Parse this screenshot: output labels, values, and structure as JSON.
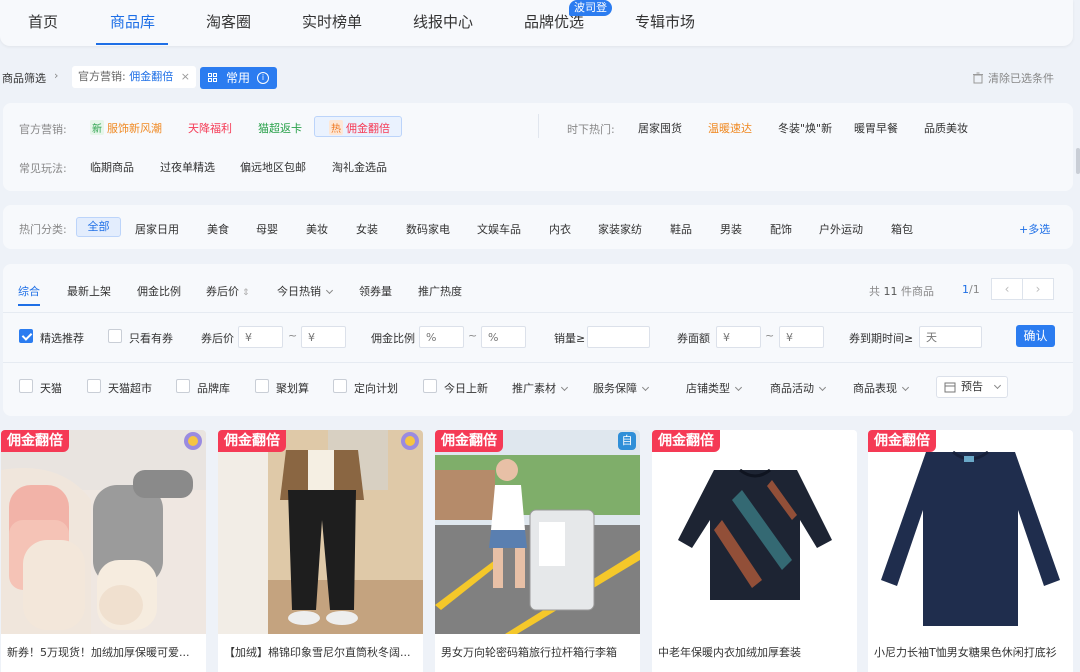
{
  "nav": {
    "items": [
      "首页",
      "商品库",
      "淘客圈",
      "实时榜单",
      "线报中心",
      "品牌优选",
      "专辑市场"
    ],
    "badge": "波司登"
  },
  "breadcrumb": {
    "root": "商品筛选",
    "chip_prefix": "官方营销:",
    "chip_value": "佣金翻倍",
    "chip_close": "×",
    "common_label": "常用",
    "info_glyph": "i",
    "clear_label": "清除已选条件"
  },
  "marketing": {
    "label": "官方营销:",
    "items": [
      {
        "badge": "新",
        "text": "服饰新风潮"
      },
      {
        "text": "天降福利"
      },
      {
        "text": "猫超返卡"
      },
      {
        "badge": "热",
        "text": "佣金翻倍"
      }
    ],
    "hot_label": "时下热门:",
    "hot_items": [
      "居家囤货",
      "温暖速达",
      "冬装\"焕\"新",
      "暖胃早餐",
      "品质美妆"
    ],
    "play_label": "常见玩法:",
    "play_items": [
      "临期商品",
      "过夜单精选",
      "偏远地区包邮",
      "淘礼金选品"
    ]
  },
  "categories": {
    "label": "热门分类:",
    "items": [
      "全部",
      "居家日用",
      "美食",
      "母婴",
      "美妆",
      "女装",
      "数码家电",
      "文娱车品",
      "内衣",
      "家装家纺",
      "鞋品",
      "男装",
      "配饰",
      "户外运动",
      "箱包"
    ],
    "more": "+多选"
  },
  "sort": {
    "items": [
      "综合",
      "最新上架",
      "佣金比例",
      "券后价",
      "今日热销",
      "领券量",
      "推广热度"
    ],
    "total_prefix": "共",
    "total_count": "11",
    "total_suffix": "件商品",
    "page": "1",
    "pages": "/1",
    "prev": "‹",
    "next": "›"
  },
  "filters": {
    "featured": "精选推荐",
    "coupon_only": "只看有券",
    "price_label": "券后价",
    "price_min_ph": "¥",
    "price_max_ph": "¥",
    "tilde": "~",
    "commission_label": "佣金比例",
    "commission_min_ph": "%",
    "commission_max_ph": "%",
    "sales_label": "销量≥",
    "coupon_value_label": "券面额",
    "coupon_min_ph": "¥",
    "coupon_max_ph": "¥",
    "expiry_label": "券到期时间≥",
    "expiry_ph": "天",
    "confirm": "确认"
  },
  "checks": [
    "天猫",
    "天猫超市",
    "品牌库",
    "聚划算",
    "定向计划",
    "今日上新"
  ],
  "dropdowns": [
    "推广素材",
    "服务保障",
    "店铺类型",
    "商品活动",
    "商品表现"
  ],
  "preview_label": "预告",
  "products": [
    {
      "tag": "佣金翻倍",
      "corner": "",
      "title": "新券！5万现货！加绒加厚保暖可爱..."
    },
    {
      "tag": "佣金翻倍",
      "corner": "",
      "title": "【加绒】棉锦印象雪尼尔直筒秋冬阔..."
    },
    {
      "tag": "佣金翻倍",
      "corner": "自",
      "title": "男女万向轮密码箱旅行拉杆箱行李箱"
    },
    {
      "tag": "佣金翻倍",
      "corner": "",
      "title": "中老年保暖内衣加绒加厚套装"
    },
    {
      "tag": "佣金翻倍",
      "corner": "",
      "title": "小尼力长袖T恤男女糖果色休闲打底衫"
    }
  ],
  "colors": {
    "accent": "#1e6fe6",
    "tag_red": "#f53a55"
  }
}
